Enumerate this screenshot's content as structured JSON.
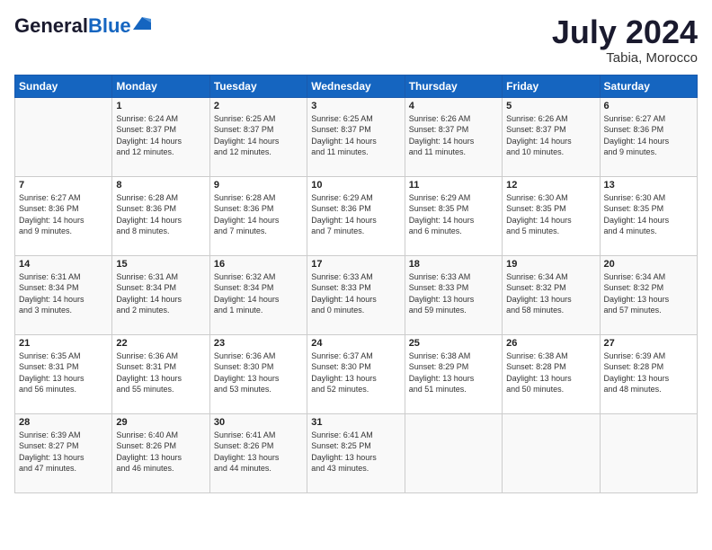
{
  "header": {
    "logo_general": "General",
    "logo_blue": "Blue",
    "month_year": "July 2024",
    "location": "Tabia, Morocco"
  },
  "weekdays": [
    "Sunday",
    "Monday",
    "Tuesday",
    "Wednesday",
    "Thursday",
    "Friday",
    "Saturday"
  ],
  "weeks": [
    [
      {
        "day": "",
        "content": ""
      },
      {
        "day": "1",
        "content": "Sunrise: 6:24 AM\nSunset: 8:37 PM\nDaylight: 14 hours\nand 12 minutes."
      },
      {
        "day": "2",
        "content": "Sunrise: 6:25 AM\nSunset: 8:37 PM\nDaylight: 14 hours\nand 12 minutes."
      },
      {
        "day": "3",
        "content": "Sunrise: 6:25 AM\nSunset: 8:37 PM\nDaylight: 14 hours\nand 11 minutes."
      },
      {
        "day": "4",
        "content": "Sunrise: 6:26 AM\nSunset: 8:37 PM\nDaylight: 14 hours\nand 11 minutes."
      },
      {
        "day": "5",
        "content": "Sunrise: 6:26 AM\nSunset: 8:37 PM\nDaylight: 14 hours\nand 10 minutes."
      },
      {
        "day": "6",
        "content": "Sunrise: 6:27 AM\nSunset: 8:36 PM\nDaylight: 14 hours\nand 9 minutes."
      }
    ],
    [
      {
        "day": "7",
        "content": "Sunrise: 6:27 AM\nSunset: 8:36 PM\nDaylight: 14 hours\nand 9 minutes."
      },
      {
        "day": "8",
        "content": "Sunrise: 6:28 AM\nSunset: 8:36 PM\nDaylight: 14 hours\nand 8 minutes."
      },
      {
        "day": "9",
        "content": "Sunrise: 6:28 AM\nSunset: 8:36 PM\nDaylight: 14 hours\nand 7 minutes."
      },
      {
        "day": "10",
        "content": "Sunrise: 6:29 AM\nSunset: 8:36 PM\nDaylight: 14 hours\nand 7 minutes."
      },
      {
        "day": "11",
        "content": "Sunrise: 6:29 AM\nSunset: 8:35 PM\nDaylight: 14 hours\nand 6 minutes."
      },
      {
        "day": "12",
        "content": "Sunrise: 6:30 AM\nSunset: 8:35 PM\nDaylight: 14 hours\nand 5 minutes."
      },
      {
        "day": "13",
        "content": "Sunrise: 6:30 AM\nSunset: 8:35 PM\nDaylight: 14 hours\nand 4 minutes."
      }
    ],
    [
      {
        "day": "14",
        "content": "Sunrise: 6:31 AM\nSunset: 8:34 PM\nDaylight: 14 hours\nand 3 minutes."
      },
      {
        "day": "15",
        "content": "Sunrise: 6:31 AM\nSunset: 8:34 PM\nDaylight: 14 hours\nand 2 minutes."
      },
      {
        "day": "16",
        "content": "Sunrise: 6:32 AM\nSunset: 8:34 PM\nDaylight: 14 hours\nand 1 minute."
      },
      {
        "day": "17",
        "content": "Sunrise: 6:33 AM\nSunset: 8:33 PM\nDaylight: 14 hours\nand 0 minutes."
      },
      {
        "day": "18",
        "content": "Sunrise: 6:33 AM\nSunset: 8:33 PM\nDaylight: 13 hours\nand 59 minutes."
      },
      {
        "day": "19",
        "content": "Sunrise: 6:34 AM\nSunset: 8:32 PM\nDaylight: 13 hours\nand 58 minutes."
      },
      {
        "day": "20",
        "content": "Sunrise: 6:34 AM\nSunset: 8:32 PM\nDaylight: 13 hours\nand 57 minutes."
      }
    ],
    [
      {
        "day": "21",
        "content": "Sunrise: 6:35 AM\nSunset: 8:31 PM\nDaylight: 13 hours\nand 56 minutes."
      },
      {
        "day": "22",
        "content": "Sunrise: 6:36 AM\nSunset: 8:31 PM\nDaylight: 13 hours\nand 55 minutes."
      },
      {
        "day": "23",
        "content": "Sunrise: 6:36 AM\nSunset: 8:30 PM\nDaylight: 13 hours\nand 53 minutes."
      },
      {
        "day": "24",
        "content": "Sunrise: 6:37 AM\nSunset: 8:30 PM\nDaylight: 13 hours\nand 52 minutes."
      },
      {
        "day": "25",
        "content": "Sunrise: 6:38 AM\nSunset: 8:29 PM\nDaylight: 13 hours\nand 51 minutes."
      },
      {
        "day": "26",
        "content": "Sunrise: 6:38 AM\nSunset: 8:28 PM\nDaylight: 13 hours\nand 50 minutes."
      },
      {
        "day": "27",
        "content": "Sunrise: 6:39 AM\nSunset: 8:28 PM\nDaylight: 13 hours\nand 48 minutes."
      }
    ],
    [
      {
        "day": "28",
        "content": "Sunrise: 6:39 AM\nSunset: 8:27 PM\nDaylight: 13 hours\nand 47 minutes."
      },
      {
        "day": "29",
        "content": "Sunrise: 6:40 AM\nSunset: 8:26 PM\nDaylight: 13 hours\nand 46 minutes."
      },
      {
        "day": "30",
        "content": "Sunrise: 6:41 AM\nSunset: 8:26 PM\nDaylight: 13 hours\nand 44 minutes."
      },
      {
        "day": "31",
        "content": "Sunrise: 6:41 AM\nSunset: 8:25 PM\nDaylight: 13 hours\nand 43 minutes."
      },
      {
        "day": "",
        "content": ""
      },
      {
        "day": "",
        "content": ""
      },
      {
        "day": "",
        "content": ""
      }
    ]
  ]
}
